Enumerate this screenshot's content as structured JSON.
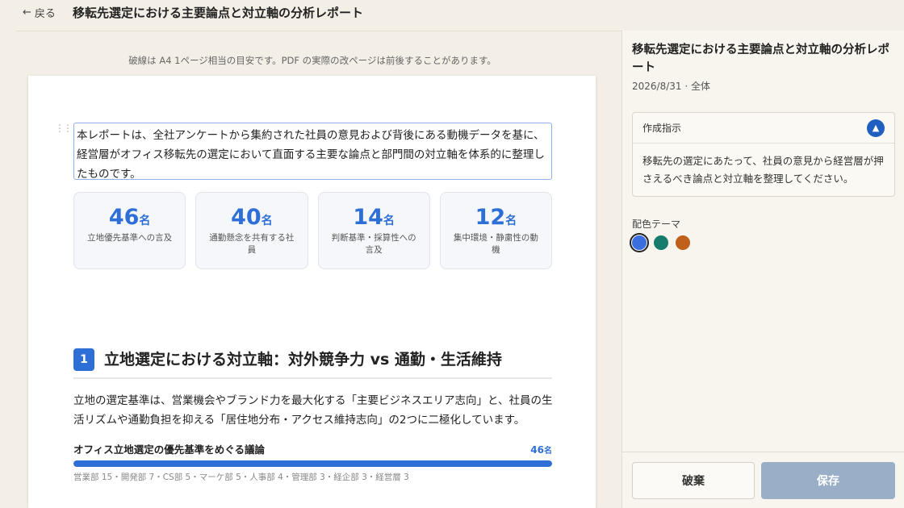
{
  "header": {
    "back_label": "戻る",
    "title": "移転先選定における主要論点と対立軸の分析レポート"
  },
  "notice": "破線は A4 1ページ相当の目安です。PDF の実際の改ページは前後することがあります。",
  "report": {
    "intro": "本レポートは、全社アンケートから集約された社員の意見および背後にある動機データを基に、経営層がオフィス移転先の選定において直面する主要な論点と部門間の対立軸を体系的に整理したものです。",
    "unit": "名",
    "stats": [
      {
        "value": "46",
        "label": "立地優先基準への言及"
      },
      {
        "value": "40",
        "label": "通勤懸念を共有する社員"
      },
      {
        "value": "14",
        "label": "判断基準・採算性への言及"
      },
      {
        "value": "12",
        "label": "集中環境・静粛性の動機"
      }
    ],
    "section": {
      "number": "1",
      "title": "立地選定における対立軸：対外競争力 vs 通勤・生活維持",
      "body": "立地の選定基準は、営業機会やブランド力を最大化する「主要ビジネスエリア志向」と、社員の生活リズムや通勤負担を抑える「居住地分布・アクセス維持志向」の2つに二極化しています。"
    },
    "bar": {
      "title": "オフィス立地選定の優先基準をめぐる議論",
      "count": "46",
      "fill_fraction": 1.0,
      "breakdown": "営業部 15・開発部 7・CS部 5・マーケ部 5・人事部 4・管理部 3・経企部 3・経営層 3"
    }
  },
  "sidebar": {
    "title": "移転先選定における主要論点と対立軸の分析レポート",
    "meta": "2026/8/31 · 全体",
    "instruction_heading": "作成指示",
    "instruction_body": "移転先の選定にあたって、社員の意見から経営層が押さえるべき論点と対立軸を整理してください。",
    "theme_label": "配色テーマ",
    "themes": [
      {
        "name": "blue",
        "color": "#3b6fe0"
      },
      {
        "name": "teal",
        "color": "#167c6e"
      },
      {
        "name": "orange",
        "color": "#c0601a"
      }
    ],
    "discard_label": "破棄",
    "save_label": "保存"
  }
}
